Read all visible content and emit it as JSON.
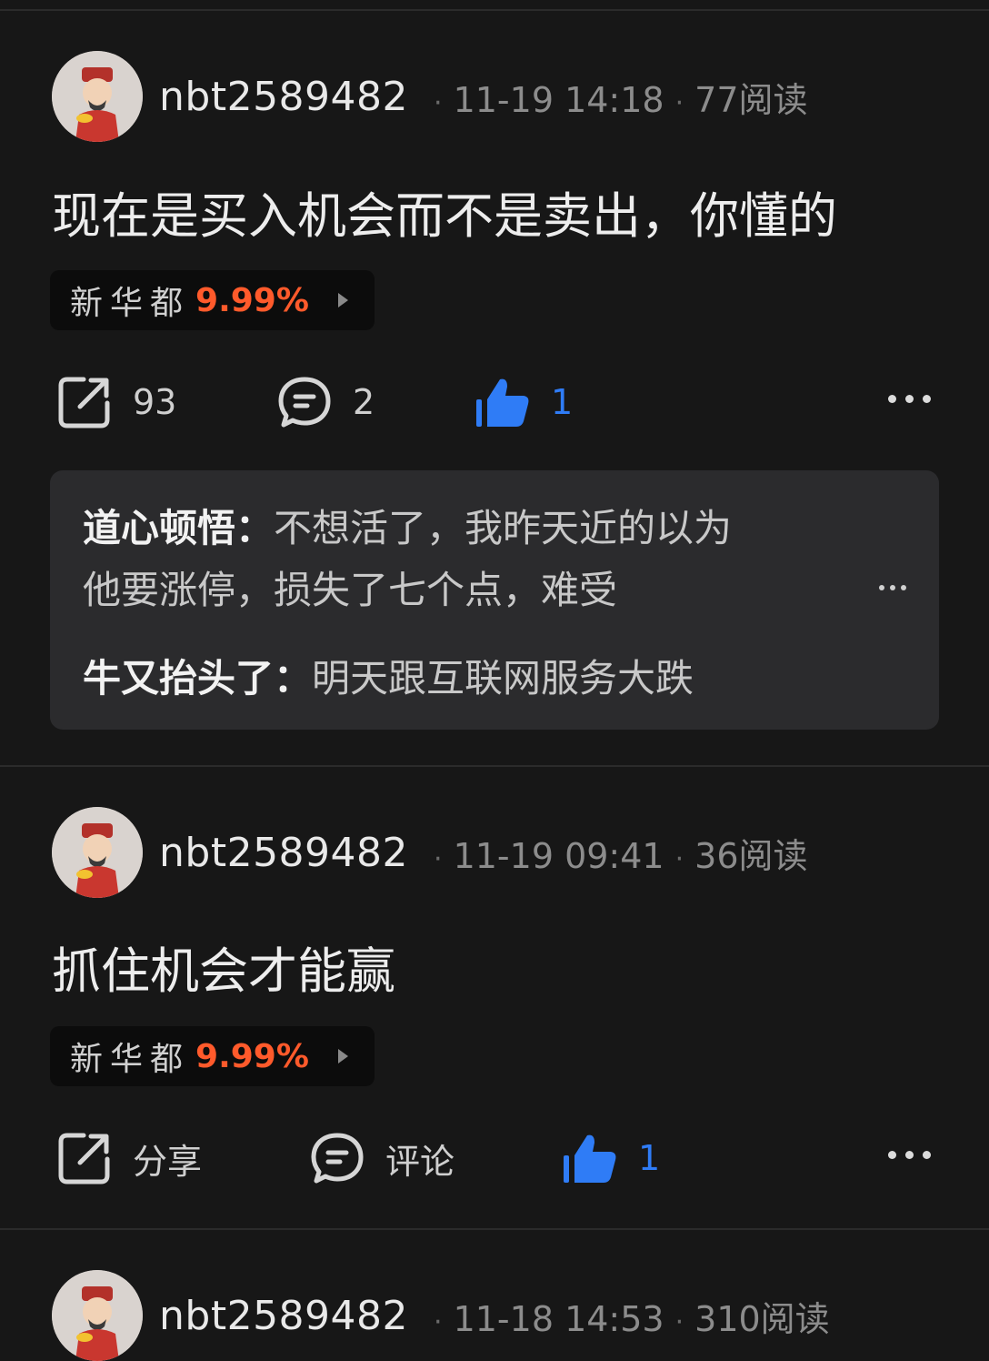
{
  "posts": [
    {
      "author": "nbt2589482",
      "time": "11-19 14:18",
      "reads": "77阅读",
      "content": "现在是买入机会而不是卖出，你懂的",
      "stock": {
        "name": "新华都",
        "change": "9.99%"
      },
      "actions": {
        "share": "93",
        "comment": "2",
        "like": "1"
      },
      "comments": [
        {
          "name": "道心顿悟：",
          "line1": "不想活了，我昨天近的以为",
          "line2": "他要涨停，损失了七个点，难受"
        },
        {
          "name": "牛又抬头了：",
          "line1": "明天跟互联网服务大跌"
        }
      ]
    },
    {
      "author": "nbt2589482",
      "time": "11-19 09:41",
      "reads": "36阅读",
      "content": "抓住机会才能赢",
      "stock": {
        "name": "新华都",
        "change": "9.99%"
      },
      "actions": {
        "share": "分享",
        "comment": "评论",
        "like": "1"
      }
    },
    {
      "author": "nbt2589482",
      "time": "11-18 14:53",
      "reads": "310阅读"
    }
  ],
  "colors": {
    "background": "#171717",
    "stock_up": "#ff5a2b",
    "like_blue": "#2f7cf6"
  },
  "icons": {
    "share": "share-icon",
    "comment": "comment-icon",
    "like": "thumbs-up-icon",
    "more": "more-icon"
  }
}
